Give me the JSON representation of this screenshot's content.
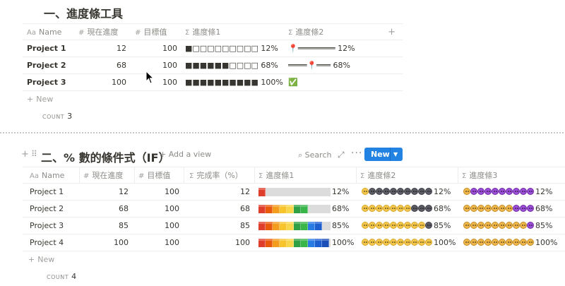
{
  "section1": {
    "title": "一、進度條工具",
    "columns": [
      {
        "icon": "Aa",
        "label": "Name"
      },
      {
        "icon": "#",
        "label": "現在進度"
      },
      {
        "icon": "#",
        "label": "目標值"
      },
      {
        "icon": "Σ",
        "label": "進度條1"
      },
      {
        "icon": "Σ",
        "label": "進度條2"
      }
    ],
    "add_column": "+",
    "rows": [
      {
        "name": "Project 1",
        "current": "12",
        "target": "100",
        "bar1": "■□□□□□□□□□ 12%",
        "bar2": "📍════════ 12%"
      },
      {
        "name": "Project 2",
        "current": "68",
        "target": "100",
        "bar1": "■■■■■■□□□□ 68%",
        "bar2": "════📍═══ 68%"
      },
      {
        "name": "Project 3",
        "current": "100",
        "target": "100",
        "bar1": "■■■■■■■■■■ 100%",
        "bar2": "✅"
      }
    ],
    "new_label": "New",
    "count_label": "COUNT",
    "count_value": "3"
  },
  "section2": {
    "title": "二、% 數的條件式（IF）",
    "add_view": "Add a view",
    "search_label": "Search",
    "new_button": "New",
    "colors": {
      "accent": "#2383e2"
    },
    "columns": [
      {
        "icon": "Aa",
        "label": "Name"
      },
      {
        "icon": "#",
        "label": "現在進度"
      },
      {
        "icon": "#",
        "label": "目標值"
      },
      {
        "icon": "Σ",
        "label": "完成率（%）"
      },
      {
        "icon": "Σ",
        "label": "進度條1"
      },
      {
        "icon": "Σ",
        "label": "進度條2"
      },
      {
        "icon": "Σ",
        "label": "進度條3"
      }
    ],
    "rows": [
      {
        "name": "Project 1",
        "current": "12",
        "target": "100",
        "rate": "12",
        "bar1_pct": "12%",
        "bar2_pct": "12%",
        "bar3_pct": "12%",
        "progress": 0.12
      },
      {
        "name": "Project 2",
        "current": "68",
        "target": "100",
        "rate": "68",
        "bar1_pct": "68%",
        "bar2_pct": "68%",
        "bar3_pct": "68%",
        "progress": 0.68
      },
      {
        "name": "Project 3",
        "current": "85",
        "target": "100",
        "rate": "85",
        "bar1_pct": "85%",
        "bar2_pct": "85%",
        "bar3_pct": "85%",
        "progress": 0.85
      },
      {
        "name": "Project 4",
        "current": "100",
        "target": "100",
        "rate": "100",
        "bar1_pct": "100%",
        "bar2_pct": "100%",
        "bar3_pct": "100%",
        "progress": 1.0
      }
    ],
    "bar1_colors": [
      "#e03e2d",
      "#e8590c",
      "#f29d1e",
      "#f7c52b",
      "#f7d64a",
      "#2fa043",
      "#39b54a",
      "#2b7be4",
      "#1e5fd0",
      "#1a4fb8"
    ],
    "new_label": "New",
    "count_label": "COUNT",
    "count_value": "4"
  }
}
